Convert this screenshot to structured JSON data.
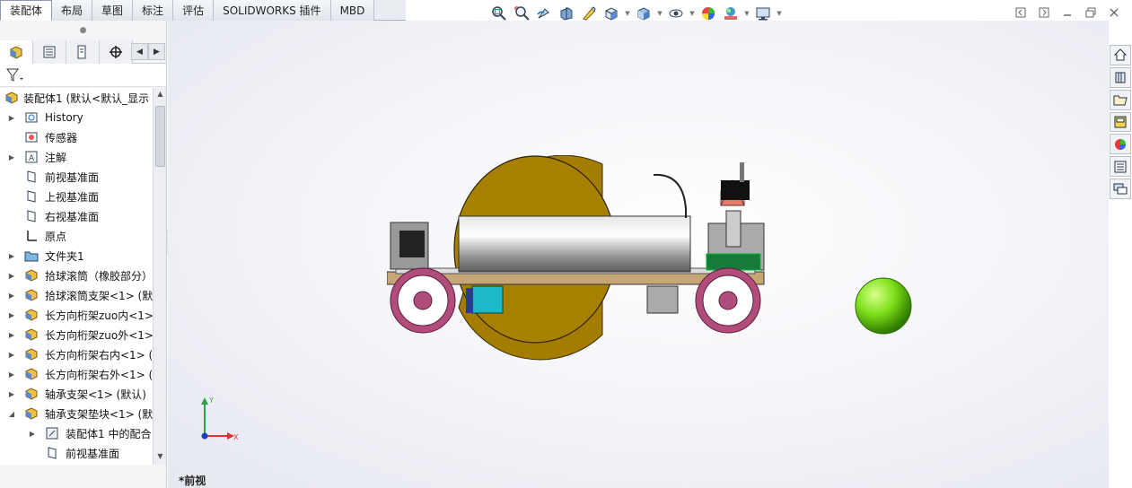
{
  "tabs": [
    {
      "label": "装配体",
      "active": true
    },
    {
      "label": "布局",
      "active": false
    },
    {
      "label": "草图",
      "active": false
    },
    {
      "label": "标注",
      "active": false
    },
    {
      "label": "评估",
      "active": false
    },
    {
      "label": "SOLIDWORKS 插件",
      "active": false
    },
    {
      "label": "MBD",
      "active": false
    }
  ],
  "hud_icons": [
    "zoom-to-fit-icon",
    "zoom-area-icon",
    "previous-view-icon",
    "section-view-icon",
    "dynamic-annotation-icon",
    "view-orientation-icon",
    "display-style-icon",
    "hide-show-icon",
    "edit-appearance-icon",
    "apply-scene-icon",
    "view-settings-icon"
  ],
  "tree": {
    "root": "装配体1  (默认<默认_显示",
    "items": [
      {
        "label": "History",
        "indent": 1,
        "expand": "right",
        "icon": "history-icon"
      },
      {
        "label": "传感器",
        "indent": 1,
        "expand": "",
        "icon": "sensor-icon"
      },
      {
        "label": "注解",
        "indent": 1,
        "expand": "right",
        "icon": "annotation-icon"
      },
      {
        "label": "前视基准面",
        "indent": 1,
        "expand": "",
        "icon": "plane-icon"
      },
      {
        "label": "上视基准面",
        "indent": 1,
        "expand": "",
        "icon": "plane-icon"
      },
      {
        "label": "右视基准面",
        "indent": 1,
        "expand": "",
        "icon": "plane-icon"
      },
      {
        "label": "原点",
        "indent": 1,
        "expand": "",
        "icon": "origin-icon"
      },
      {
        "label": "文件夹1",
        "indent": 1,
        "expand": "right",
        "icon": "folder-icon"
      },
      {
        "label": "拾球滚筒（橡胶部分）",
        "indent": 1,
        "expand": "right",
        "icon": "part-icon"
      },
      {
        "label": "拾球滚筒支架<1> (默",
        "indent": 1,
        "expand": "right",
        "icon": "part-icon"
      },
      {
        "label": "长方向桁架zuo内<1>",
        "indent": 1,
        "expand": "right",
        "icon": "part-icon"
      },
      {
        "label": "长方向桁架zuo外<1>",
        "indent": 1,
        "expand": "right",
        "icon": "part-icon"
      },
      {
        "label": "长方向桁架右内<1> (",
        "indent": 1,
        "expand": "right",
        "icon": "part-icon"
      },
      {
        "label": "长方向桁架右外<1> (",
        "indent": 1,
        "expand": "right",
        "icon": "part-icon"
      },
      {
        "label": "轴承支架<1> (默认)",
        "indent": 1,
        "expand": "right",
        "icon": "part-icon"
      },
      {
        "label": "轴承支架垫块<1> (默",
        "indent": 1,
        "expand": "down",
        "icon": "part-icon"
      },
      {
        "label": "装配体1 中的配合",
        "indent": 2,
        "expand": "right",
        "icon": "mates-icon"
      },
      {
        "label": "前视基准面",
        "indent": 2,
        "expand": "",
        "icon": "plane-icon"
      }
    ]
  },
  "view_label": "*前视",
  "triad": {
    "y_label": "Y",
    "x_label": "X"
  },
  "task_pane_icons": [
    "solidworks-resources-icon",
    "design-library-icon",
    "file-explorer-icon",
    "view-palette-icon",
    "appearances-icon",
    "custom-properties-icon",
    "forum-icon"
  ]
}
